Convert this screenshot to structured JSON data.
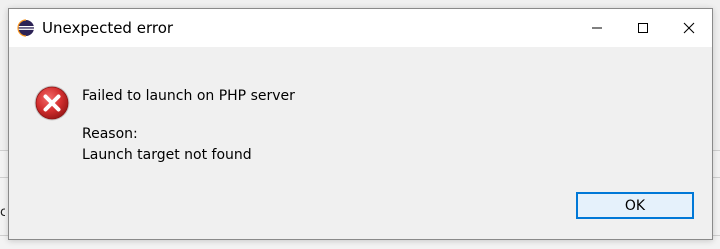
{
  "dialog": {
    "title": "Unexpected error",
    "message": "Failed to launch on PHP server",
    "reason_label": "Reason:",
    "reason_text": "Launch target not found",
    "ok_label": "OK"
  },
  "icons": {
    "app": "eclipse-icon",
    "error": "error-icon",
    "minimize": "minimize-icon",
    "maximize": "maximize-icon",
    "close": "close-icon"
  },
  "colors": {
    "error_red": "#d32f2f",
    "focus_border": "#0078d7",
    "eclipse_purple": "#2c2255",
    "eclipse_orange": "#f7941e"
  }
}
